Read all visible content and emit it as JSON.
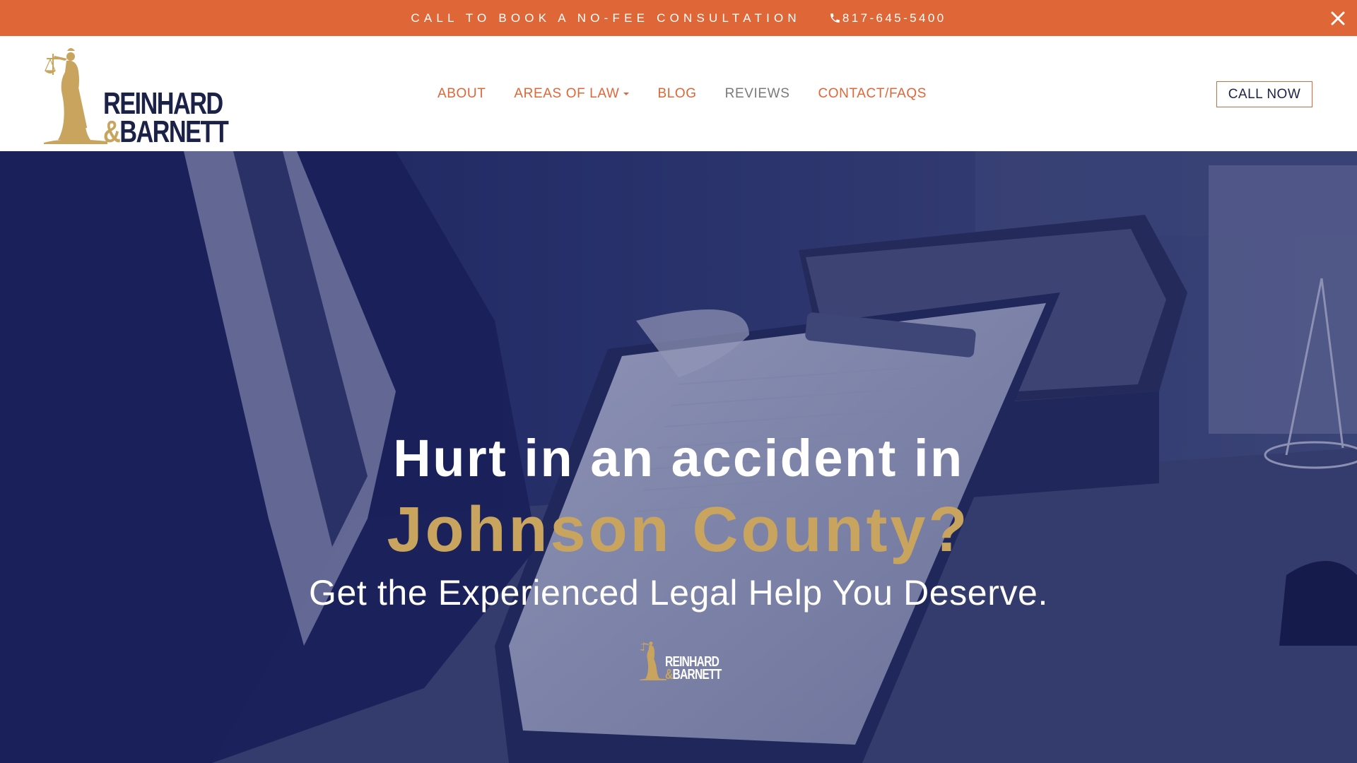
{
  "topbar": {
    "cta": "CALL TO BOOK A NO-FEE CONSULTATION",
    "phone": "817-645-5400",
    "phone_icon": "phone-icon",
    "close_icon": "close-icon"
  },
  "header": {
    "logo": {
      "line1": "REINHARD",
      "amp": "&",
      "line2": "BARNETT"
    },
    "nav": [
      {
        "label": "ABOUT"
      },
      {
        "label": "AREAS OF LAW"
      },
      {
        "label": "BLOG"
      },
      {
        "label": "REVIEWS"
      },
      {
        "label": "CONTACT/FAQS"
      }
    ],
    "call_now": "CALL NOW"
  },
  "hero": {
    "headline_1": "Hurt in an accident in",
    "headline_2": "Johnson County?",
    "subheadline": "Get the Experienced Legal Help You Deserve.",
    "logo": {
      "line1": "REINHARD",
      "amp": "&",
      "line2": "BARNETT"
    }
  },
  "colors": {
    "accent": "#DF6637",
    "navy": "#1B2147",
    "gold": "#C8A45E",
    "hero_overlay": "#27305F"
  }
}
